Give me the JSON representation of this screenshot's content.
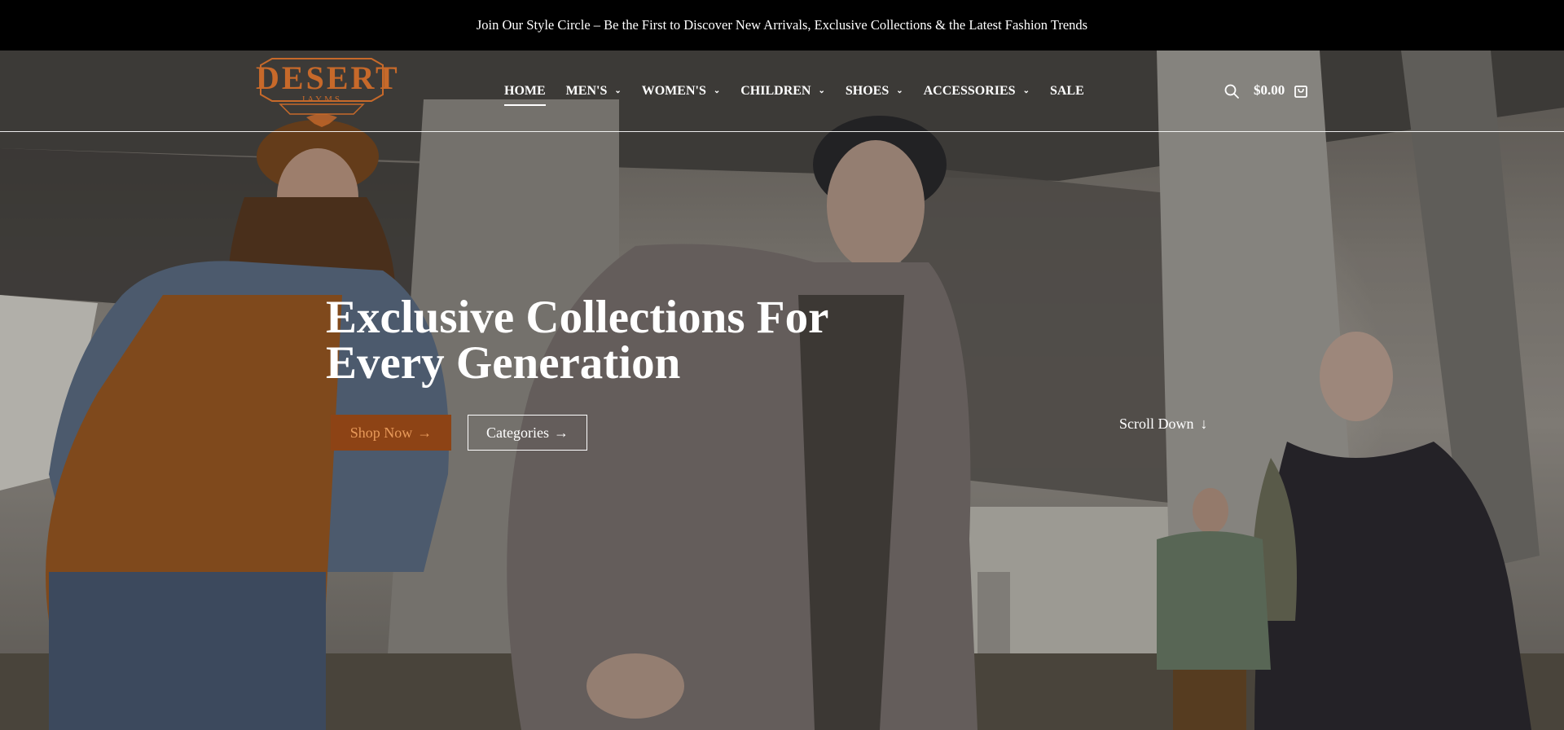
{
  "announcement": {
    "text": "Join Our Style Circle – Be the First to Discover New Arrivals, Exclusive Collections & the Latest Fashion Trends"
  },
  "header": {
    "logo": {
      "word": "DESERT",
      "sub": "JAYMS"
    },
    "nav": [
      {
        "label": "HOME",
        "active": true,
        "dropdown": false
      },
      {
        "label": "MEN'S",
        "active": false,
        "dropdown": true
      },
      {
        "label": "WOMEN'S",
        "active": false,
        "dropdown": true
      },
      {
        "label": "CHILDREN",
        "active": false,
        "dropdown": true
      },
      {
        "label": "SHOES",
        "active": false,
        "dropdown": true
      },
      {
        "label": "ACCESSORIES",
        "active": false,
        "dropdown": true
      },
      {
        "label": "SALE",
        "active": false,
        "dropdown": false
      }
    ],
    "cart_total": "$0.00",
    "icons": {
      "search": "search-icon",
      "cart": "shopping-bag-icon",
      "dropdown": "chevron-down-icon"
    }
  },
  "hero": {
    "title_line1": "Exclusive Collections For",
    "title_line2": "Every Generation",
    "shop_button": "Shop Now",
    "categories_button": "Categories",
    "scroll_down": "Scroll Down",
    "icons": {
      "button_arrow": "arrow-right-icon",
      "scroll_arrow": "arrow-down-icon"
    }
  },
  "colors": {
    "brand": "#c7692a",
    "shop_button_bg": "#8d4315",
    "shop_button_text": "#e89a5a",
    "announcement_bg": "#000000",
    "text": "#ffffff"
  }
}
